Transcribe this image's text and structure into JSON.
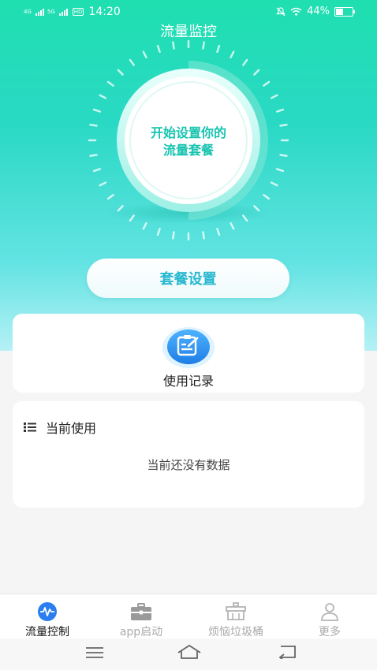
{
  "status_bar": {
    "network1": "4G",
    "network2": "5G",
    "hd_badge": "HD",
    "time": "14:20",
    "battery": "44%"
  },
  "header": {
    "title": "流量监控"
  },
  "dial": {
    "prompt_line1": "开始设置你的",
    "prompt_line2": "流量套餐"
  },
  "plan_button": {
    "label": "套餐设置"
  },
  "usage_record": {
    "label": "使用记录"
  },
  "current_usage": {
    "title": "当前使用",
    "empty_text": "当前还没有数据"
  },
  "tabs": [
    {
      "label": "流量控制",
      "icon": "pulse-icon",
      "active": true
    },
    {
      "label": "app启动",
      "icon": "briefcase-icon",
      "active": false
    },
    {
      "label": "烦恼垃圾桶",
      "icon": "trash-bin-icon",
      "active": false
    },
    {
      "label": "更多",
      "icon": "person-icon",
      "active": false
    }
  ],
  "colors": {
    "accent": "#17c3b0",
    "button_text": "#27b8d0",
    "tab_active_icon": "#2a7ef0"
  }
}
